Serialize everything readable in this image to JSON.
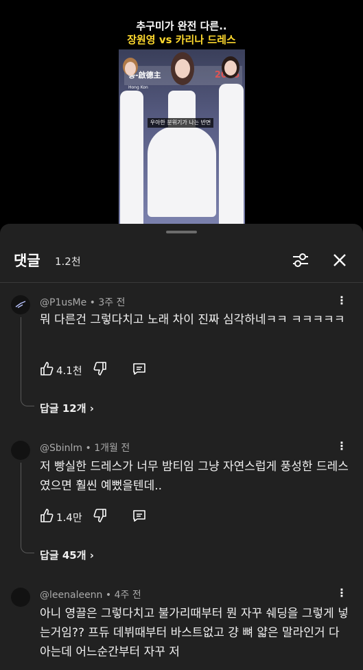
{
  "video": {
    "title_line1": "추구미가 완전 다른..",
    "title_line2": "장원영 vs 카리나 드레스",
    "sign_text": "롱-啟德主",
    "sign_sub": "Hong Kon",
    "sign_year": "2026",
    "subtitle": "우아한 분위기가 나는 반면"
  },
  "sheet": {
    "title": "댓글",
    "count": "1.2천",
    "filter_icon": "sliders-icon",
    "close_icon": "close-icon"
  },
  "comments": [
    {
      "author": "@P1usMe",
      "time": "3주 전",
      "text": "뭐 다른건 그렇다치고 노래 차이 진짜 심각하네ㅋㅋ ㅋㅋㅋㅋㅋ",
      "likes": "4.1천",
      "replies": "답글 12개"
    },
    {
      "author": "@Sbinlm",
      "time": "1개월 전",
      "text": "저 빵실한 드레스가 너무 밤티임 그냥 자연스럽게 풍성한 드레스였으면 훨씬 예뻤을텐데..",
      "likes": "1.4만",
      "replies": "답글 45개"
    },
    {
      "author": "@leenaleenn",
      "time": "4주 전",
      "text": "아니 영끌은 그렇다치고 불가리때부터 뭔 자꾸 쉐딩을 그렇게 넣는거임?? 프듀 데뷔때부터 바스트없고 걍 뼈 얇은 말라인거 다 아는데 어느순간부터 자꾸 저"
    }
  ],
  "meta_sep": "•",
  "more_label": "⋮"
}
